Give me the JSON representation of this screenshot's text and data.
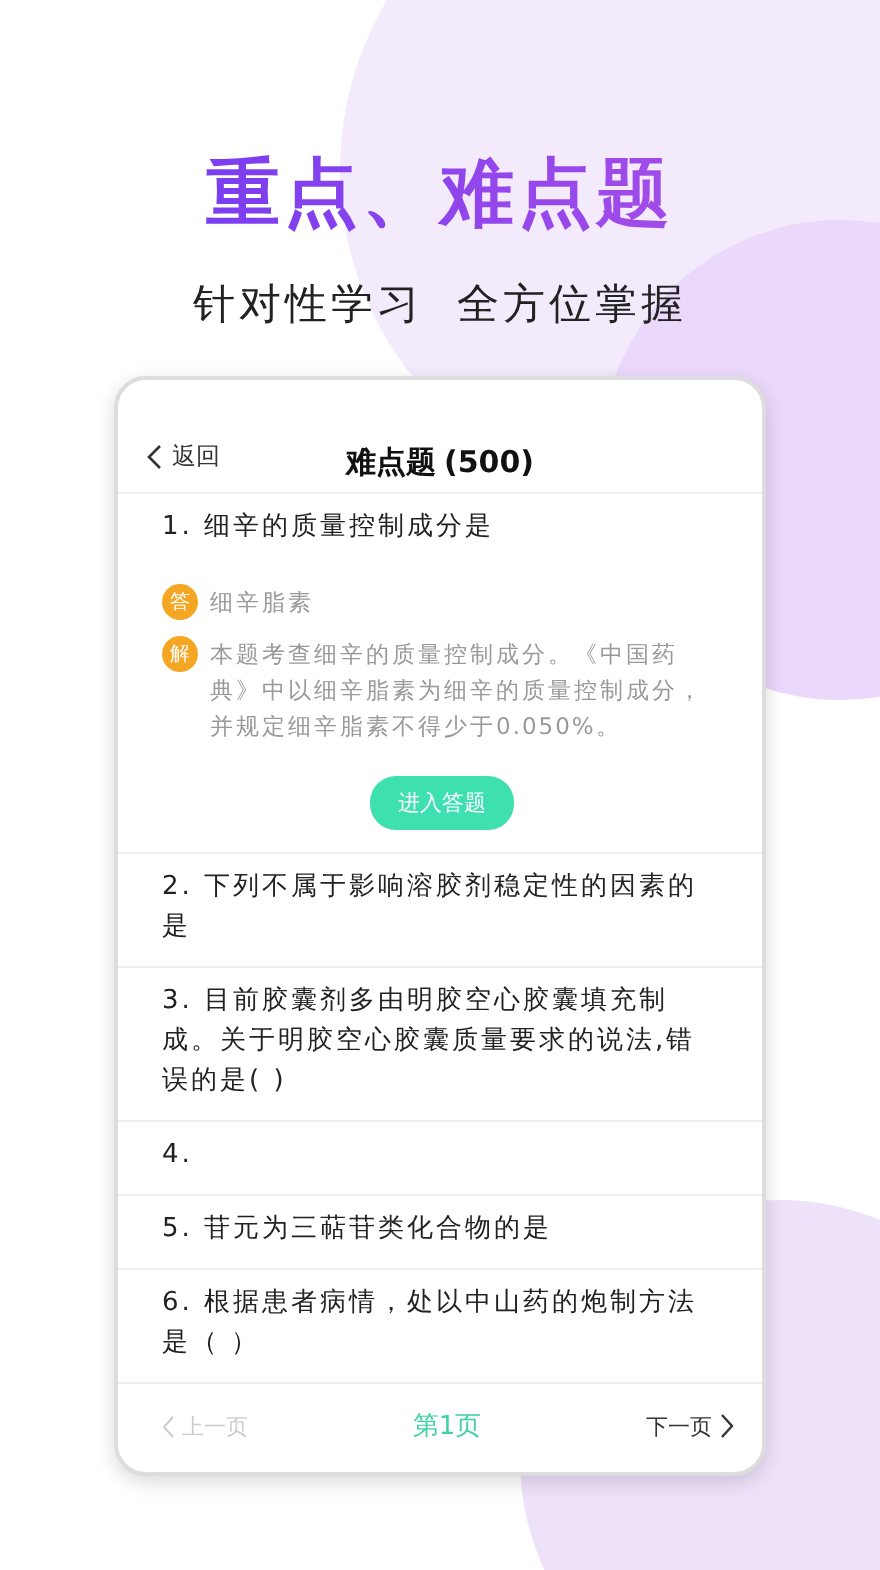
{
  "headline": "重点、难点题",
  "subtitle": "针对性学习  全方位掌握",
  "nav": {
    "back": "返回",
    "title": "难点题",
    "count": "(500)"
  },
  "questions": [
    {
      "text": "1. 细辛的质量控制成分是",
      "answer_badge": "答",
      "answer": "细辛脂素",
      "explain_badge": "解",
      "explanation": "本题考查细辛的质量控制成分。《中国药典》中以细辛脂素为细辛的质量控制成分，并规定细辛脂素不得少于0.050%。",
      "button": "进入答题"
    },
    {
      "text": "2. 下列不属于影响溶胶剂稳定性的因素的是"
    },
    {
      "text": "3. 目前胶囊剂多由明胶空心胶囊填充制成。关于明胶空心胶囊质量要求的说法,错误的是( )"
    },
    {
      "text": "4."
    },
    {
      "text": "5. 苷元为三萜苷类化合物的是"
    },
    {
      "text": "6. 根据患者病情，处以中山药的炮制方法是（  ）"
    }
  ],
  "pager": {
    "prev": {
      "label": "上一页",
      "disabled": true
    },
    "current": "第1页",
    "next": {
      "label": "下一页",
      "disabled": false
    }
  }
}
